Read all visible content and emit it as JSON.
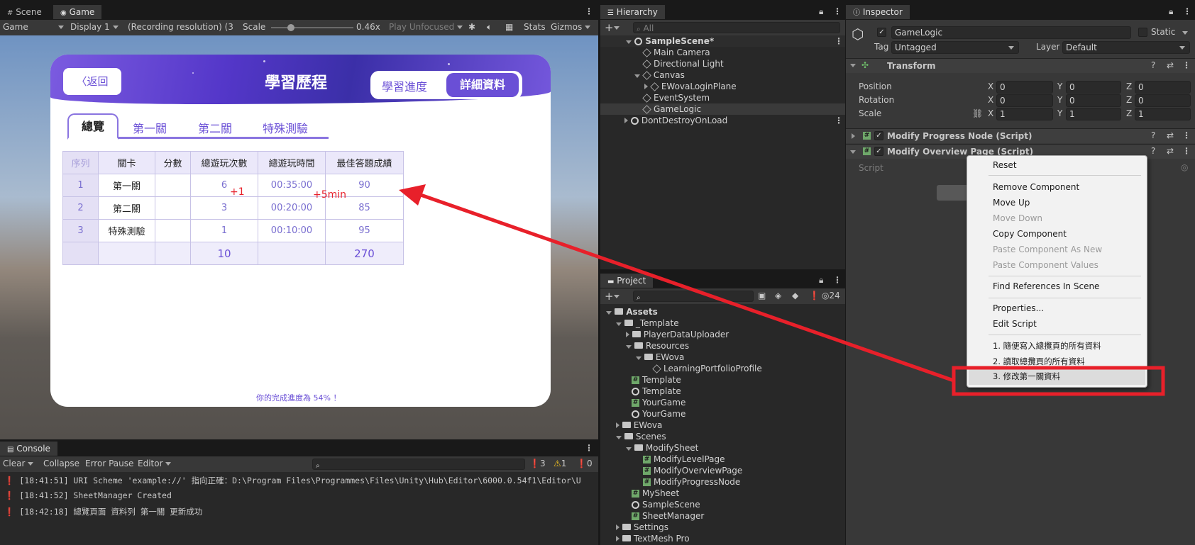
{
  "scene_game": {
    "tabs": [
      "Scene",
      "Game"
    ],
    "toolbar": {
      "mode": "Game",
      "display": "Display 1",
      "resolution": "(Recording resolution) (3(",
      "scale_label": "Scale",
      "scale_value": "0.46x",
      "play_mode": "Play Unfocused",
      "stats": "Stats",
      "gizmos": "Gizmos"
    }
  },
  "game": {
    "back": "返回",
    "title": "學習歷程",
    "tabs_right": [
      "學習進度",
      "詳細資料"
    ],
    "sub_tabs": [
      "總覽",
      "第一關",
      "第二關",
      "特殊測驗"
    ],
    "table": {
      "headers": [
        "序列",
        "關卡",
        "分數",
        "總遊玩次數",
        "總遊玩時間",
        "最佳答題成績"
      ],
      "rows": [
        [
          "1",
          "第一關",
          "",
          "6",
          "00:35:00",
          "90"
        ],
        [
          "2",
          "第二關",
          "",
          "3",
          "00:20:00",
          "85"
        ],
        [
          "3",
          "特殊測驗",
          "",
          "1",
          "00:10:00",
          "95"
        ]
      ],
      "totals": [
        "",
        "",
        "",
        "10",
        "",
        "270"
      ]
    },
    "annot_plus1": "+1",
    "annot_plus5": "+5min",
    "footer": "你的完成進度為 54% ！"
  },
  "console": {
    "tab": "Console",
    "buttons": [
      "Clear",
      "Collapse",
      "Error Pause",
      "Editor"
    ],
    "counts": [
      "3",
      "1",
      "0"
    ],
    "logs": [
      "[18:41:51] URI Scheme 'example://' 指向正確：D:\\Program Files\\Programmes\\Files\\Unity\\Hub\\Editor\\6000.0.54f1\\Editor\\U",
      "[18:41:52] SheetManager Created",
      "[18:42:18] 總覽頁面 資料列 第一關 更新成功"
    ]
  },
  "hierarchy": {
    "tab": "Hierarchy",
    "search_placeholder": "All",
    "items": [
      {
        "label": "SampleScene*",
        "depth": 0
      },
      {
        "label": "Main Camera",
        "depth": 1
      },
      {
        "label": "Directional Light",
        "depth": 1
      },
      {
        "label": "Canvas",
        "depth": 1
      },
      {
        "label": "EWovaLoginPlane",
        "depth": 2
      },
      {
        "label": "EventSystem",
        "depth": 1
      },
      {
        "label": "GameLogic",
        "depth": 1
      },
      {
        "label": "DontDestroyOnLoad",
        "depth": 0
      }
    ]
  },
  "project": {
    "tab": "Project",
    "count": "24",
    "items": [
      {
        "label": "Assets",
        "depth": 0,
        "icon": "folder"
      },
      {
        "label": "_Template",
        "depth": 1,
        "icon": "folder"
      },
      {
        "label": "PlayerDataUploader",
        "depth": 2,
        "icon": "folder"
      },
      {
        "label": "Resources",
        "depth": 2,
        "icon": "folder"
      },
      {
        "label": "EWova",
        "depth": 3,
        "icon": "folder"
      },
      {
        "label": "LearningPortfolioProfile",
        "depth": 4,
        "icon": "scriptable-icon"
      },
      {
        "label": "Template",
        "depth": 2,
        "icon": "hash"
      },
      {
        "label": "Template",
        "depth": 2,
        "icon": "unity"
      },
      {
        "label": "YourGame",
        "depth": 2,
        "icon": "hash"
      },
      {
        "label": "YourGame",
        "depth": 2,
        "icon": "unity"
      },
      {
        "label": "EWova",
        "depth": 1,
        "icon": "folder"
      },
      {
        "label": "Scenes",
        "depth": 1,
        "icon": "folder"
      },
      {
        "label": "ModifySheet",
        "depth": 2,
        "icon": "folder"
      },
      {
        "label": "ModifyLevelPage",
        "depth": 3,
        "icon": "hash"
      },
      {
        "label": "ModifyOverviewPage",
        "depth": 3,
        "icon": "hash"
      },
      {
        "label": "ModifyProgressNode",
        "depth": 3,
        "icon": "hash"
      },
      {
        "label": "MySheet",
        "depth": 2,
        "icon": "hash"
      },
      {
        "label": "SampleScene",
        "depth": 2,
        "icon": "unity"
      },
      {
        "label": "SheetManager",
        "depth": 2,
        "icon": "hash"
      },
      {
        "label": "Settings",
        "depth": 1,
        "icon": "folder"
      },
      {
        "label": "TextMesh Pro",
        "depth": 1,
        "icon": "folder"
      }
    ]
  },
  "inspector": {
    "tab": "Inspector",
    "object_name": "GameLogic",
    "static_label": "Static",
    "tag_label": "Tag",
    "tag_value": "Untagged",
    "layer_label": "Layer",
    "layer_value": "Default",
    "transform": "Transform",
    "position_label": "Position",
    "rotation_label": "Rotation",
    "scale_label": "Scale",
    "position": [
      "0",
      "0",
      "0"
    ],
    "rotation": [
      "0",
      "0",
      "0"
    ],
    "scale": [
      "1",
      "1",
      "1"
    ],
    "axes": [
      "X",
      "Y",
      "Z"
    ],
    "component1": "Modify Progress Node (Script)",
    "component2": "Modify Overview Page (Script)",
    "script_label": "Script"
  },
  "context_menu": {
    "items": [
      {
        "label": "Reset",
        "disabled": false
      },
      {
        "label": "Remove Component",
        "disabled": false
      },
      {
        "label": "Move Up",
        "disabled": false
      },
      {
        "label": "Move Down",
        "disabled": true
      },
      {
        "label": "Copy Component",
        "disabled": false
      },
      {
        "label": "Paste Component As New",
        "disabled": true
      },
      {
        "label": "Paste Component Values",
        "disabled": true
      },
      {
        "label": "Find References In Scene",
        "disabled": false
      },
      {
        "label": "Properties...",
        "disabled": false
      },
      {
        "label": "Edit Script",
        "disabled": false
      },
      {
        "label": "1. 隨便寫入總攬頁的所有資料",
        "disabled": false
      },
      {
        "label": "2. 讀取總攬頁的所有資料",
        "disabled": false
      },
      {
        "label": "3. 修改第一關資料",
        "disabled": false
      }
    ]
  },
  "colors": {
    "highlight": "#e8202a",
    "purple": "#6a4fd6"
  }
}
